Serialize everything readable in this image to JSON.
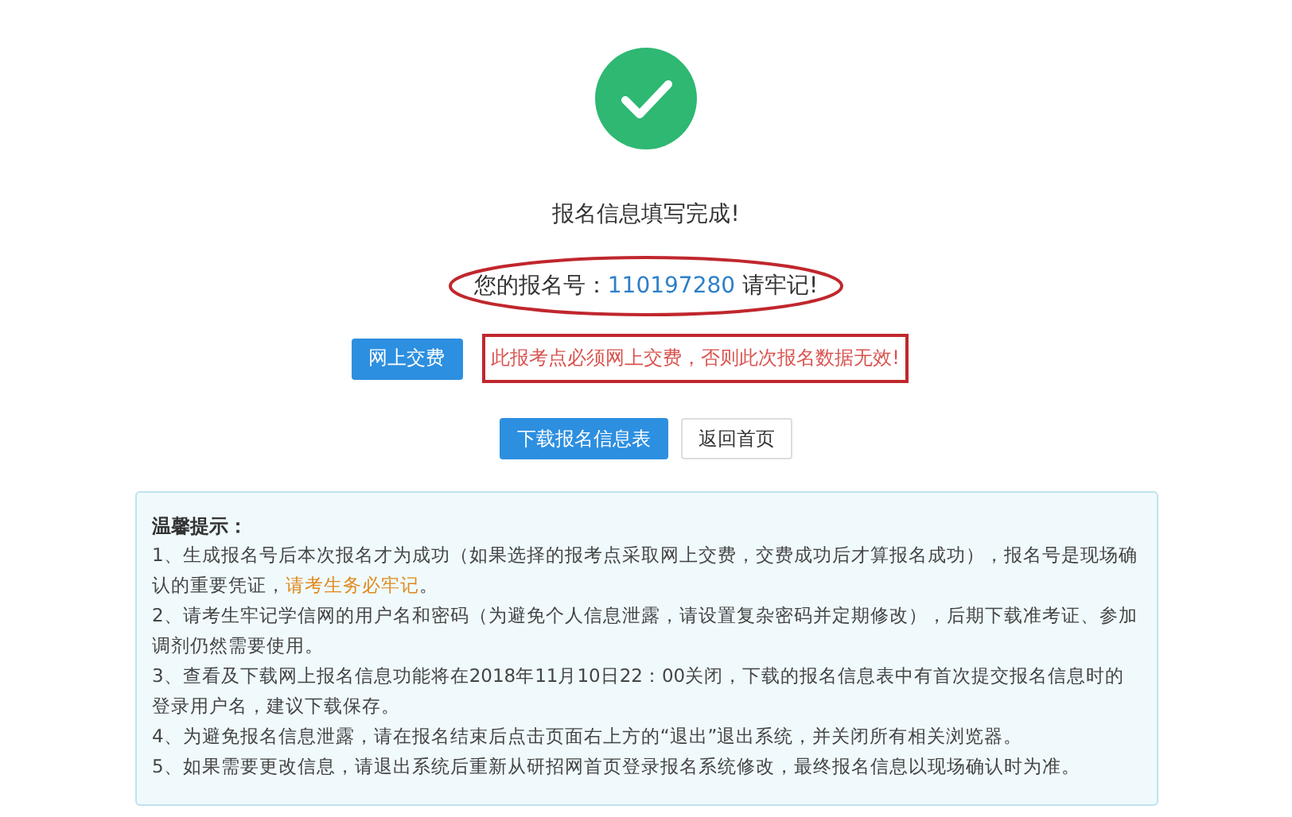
{
  "title": "报名信息填写完成!",
  "registration": {
    "label": "您的报名号：",
    "number": "110197280",
    "suffix": "请牢记!"
  },
  "pay_button": "网上交费",
  "pay_warning": "此报考点必须网上交费，否则此次报名数据无效!",
  "actions": [
    {
      "label": "下载报名信息表",
      "kind": "primary"
    },
    {
      "label": "返回首页",
      "kind": "default"
    }
  ],
  "notice": {
    "title": "温馨提示：",
    "items": [
      [
        {
          "text": "1、生成报名号后本次报名才为成功（如果选择的报考点采取网上交费，交费成功后才算报名成功），报名号是现场确认的重要凭证，",
          "highlight": false
        },
        {
          "text": "请考生务必牢记",
          "highlight": true
        },
        {
          "text": "。",
          "highlight": false
        }
      ],
      [
        {
          "text": "2、请考生牢记学信网的用户名和密码（为避免个人信息泄露，请设置复杂密码并定期修改），后期下载准考证、参加调剂仍然需要使用。",
          "highlight": false
        }
      ],
      [
        {
          "text": "3、查看及下载网上报名信息功能将在2018年11月10日22：00关闭，下载的报名信息表中有首次提交报名信息时的登录用户名，建议下载保存。",
          "highlight": false
        }
      ],
      [
        {
          "text": "4、为避免报名信息泄露，请在报名结束后点击页面右上方的“退出”退出系统，并关闭所有相关浏览器。",
          "highlight": false
        }
      ],
      [
        {
          "text": "5、如果需要更改信息，请退出系统后重新从研招网首页登录报名系统修改，最终报名信息以现场确认时为准。",
          "highlight": false
        }
      ]
    ]
  }
}
